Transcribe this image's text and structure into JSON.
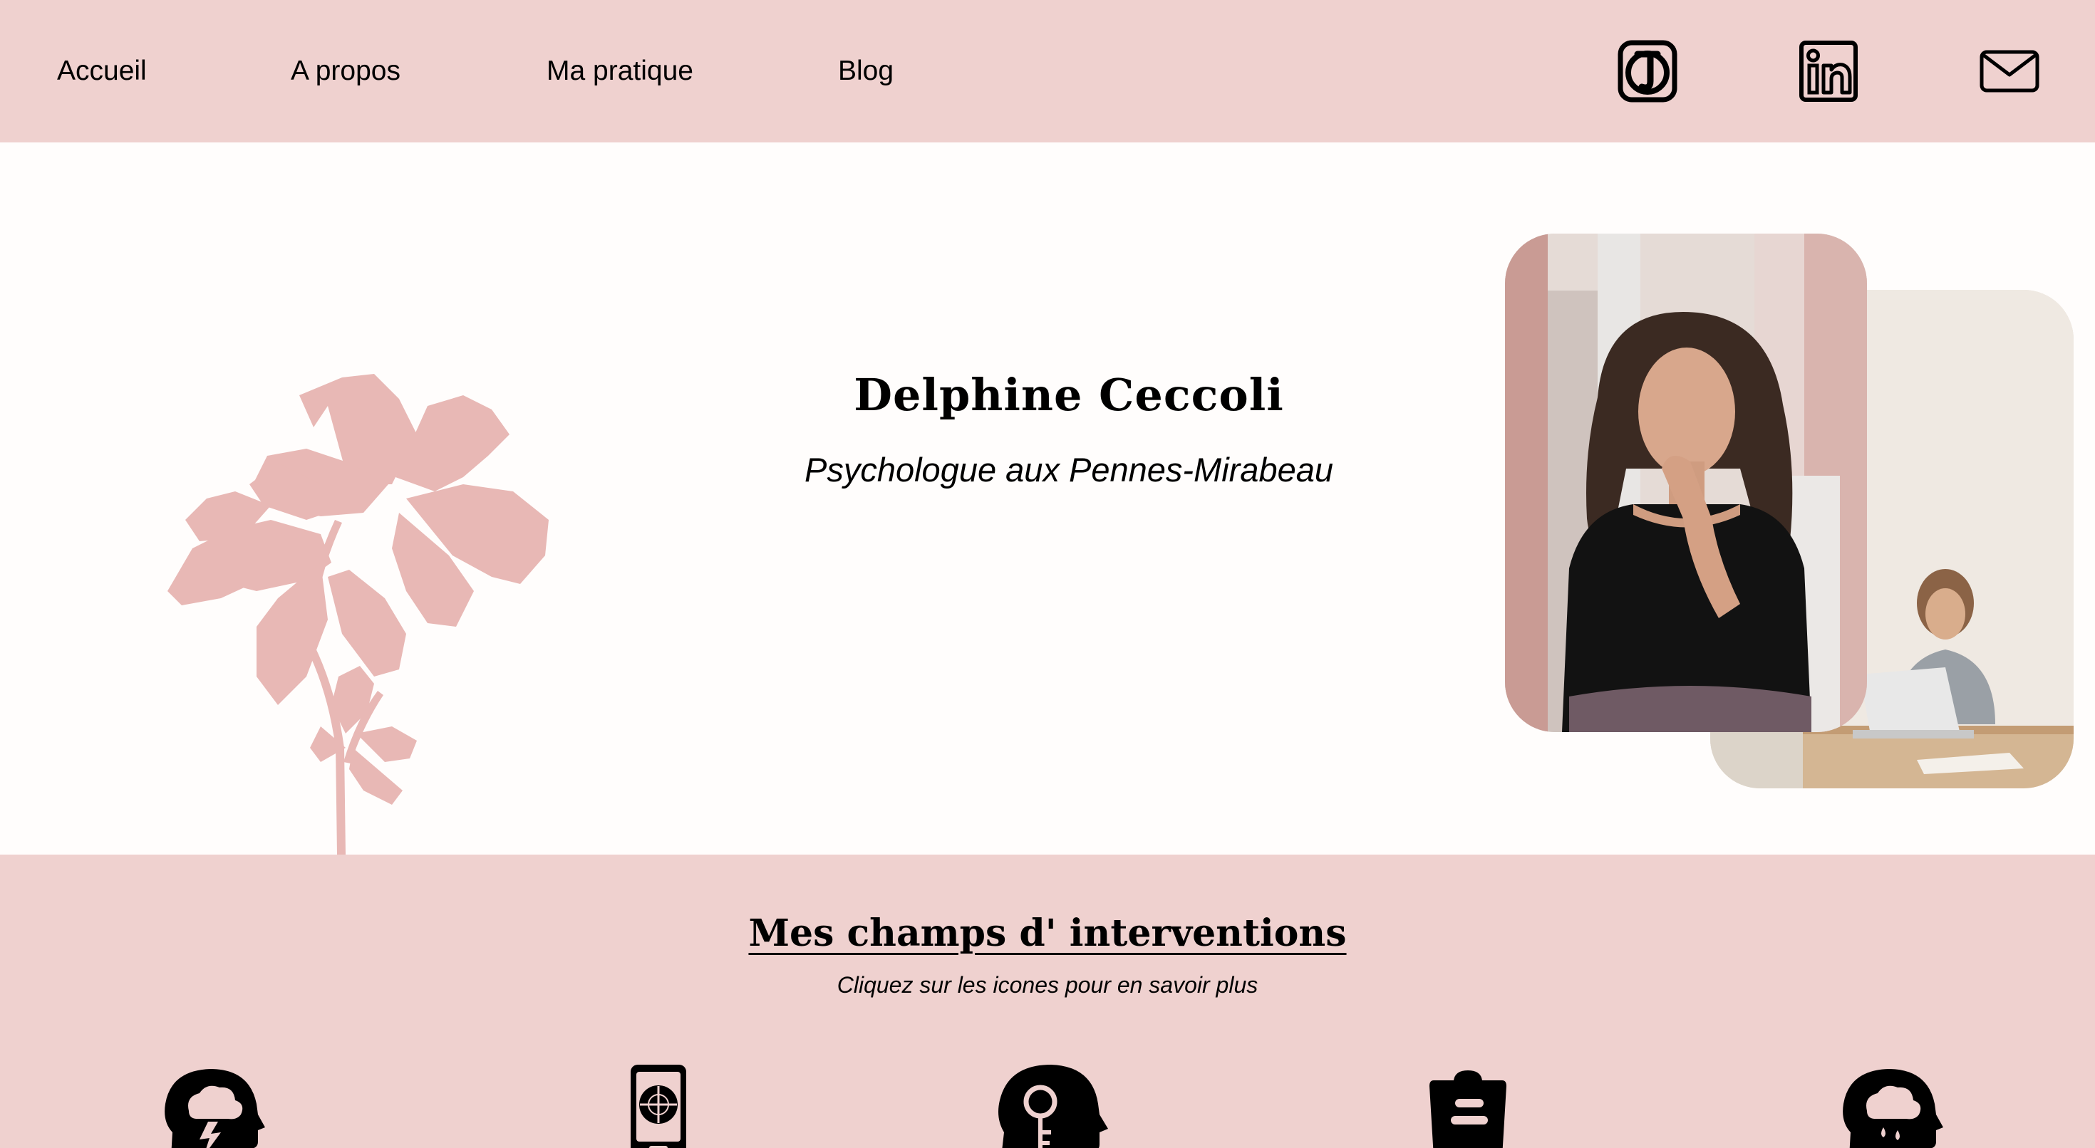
{
  "nav": {
    "items": [
      {
        "label": "Accueil"
      },
      {
        "label": "A propos"
      },
      {
        "label": "Ma pratique"
      },
      {
        "label": "Blog"
      }
    ],
    "social": [
      {
        "icon": "doctolib-icon"
      },
      {
        "icon": "linkedin-icon"
      },
      {
        "icon": "mail-icon"
      }
    ]
  },
  "hero": {
    "name": "Delphine Ceccoli",
    "subtitle": "Psychologue aux Pennes-Mirabeau"
  },
  "interventions": {
    "title": "Mes champs d' interventions",
    "hint": "Cliquez sur les icones pour en savoir plus",
    "icons": [
      {
        "icon": "head-storm-icon"
      },
      {
        "icon": "phone-screen-icon"
      },
      {
        "icon": "head-key-icon"
      },
      {
        "icon": "clipboard-icon"
      },
      {
        "icon": "head-rain-icon"
      }
    ]
  },
  "colors": {
    "header_bg": "#efd1cf",
    "hero_bg": "#fffdfc",
    "flower": "#e8b8b5"
  }
}
